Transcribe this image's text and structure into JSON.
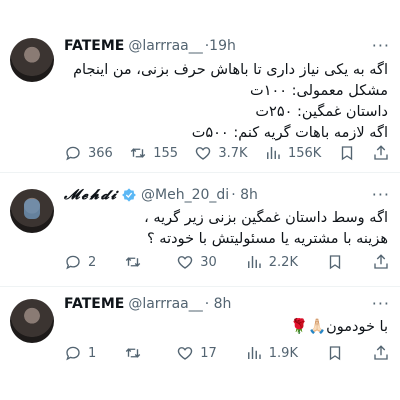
{
  "tweets": [
    {
      "name": "FATEME",
      "handle": "@larrraa__",
      "time": "·19h",
      "more": "···",
      "lines": [
        "اگه به یکی نیاز داری تا باهاش حرف بزنی، من اینجام",
        "مشکل معمولی: ۱۰۰ت",
        "داستان غمگین: ۲۵۰ت",
        "اگه لازمه باهات گریه کنم: ۵۰۰ت"
      ],
      "replies": "366",
      "retweets": "155",
      "likes": "3.7K",
      "views": "156K"
    },
    {
      "name": "𝓜𝓮𝓱𝓭𝓲",
      "verified_color": "#5bb8f5",
      "handle": "@Meh_20_di",
      "time": "· 8h",
      "more": "···",
      "lines": [
        "اگه وسط داستان غمگین بزنی زیر گریه ،",
        "هزینه با مشتریه یا مسئولیتش با خودته ؟"
      ],
      "replies": "2",
      "retweets": "",
      "likes": "30",
      "views": "2.2K"
    },
    {
      "name": "FATEME",
      "handle": "@larrraa__",
      "time": "· 8h",
      "more": "···",
      "lines": [
        "با خودمون🙏🏻🌹"
      ],
      "replies": "1",
      "retweets": "",
      "likes": "17",
      "views": "1.9K"
    }
  ],
  "colors": {
    "text": "#0f1419",
    "muted": "#536471",
    "separator": "#eff3f4",
    "verified": "#5bb8f5"
  }
}
